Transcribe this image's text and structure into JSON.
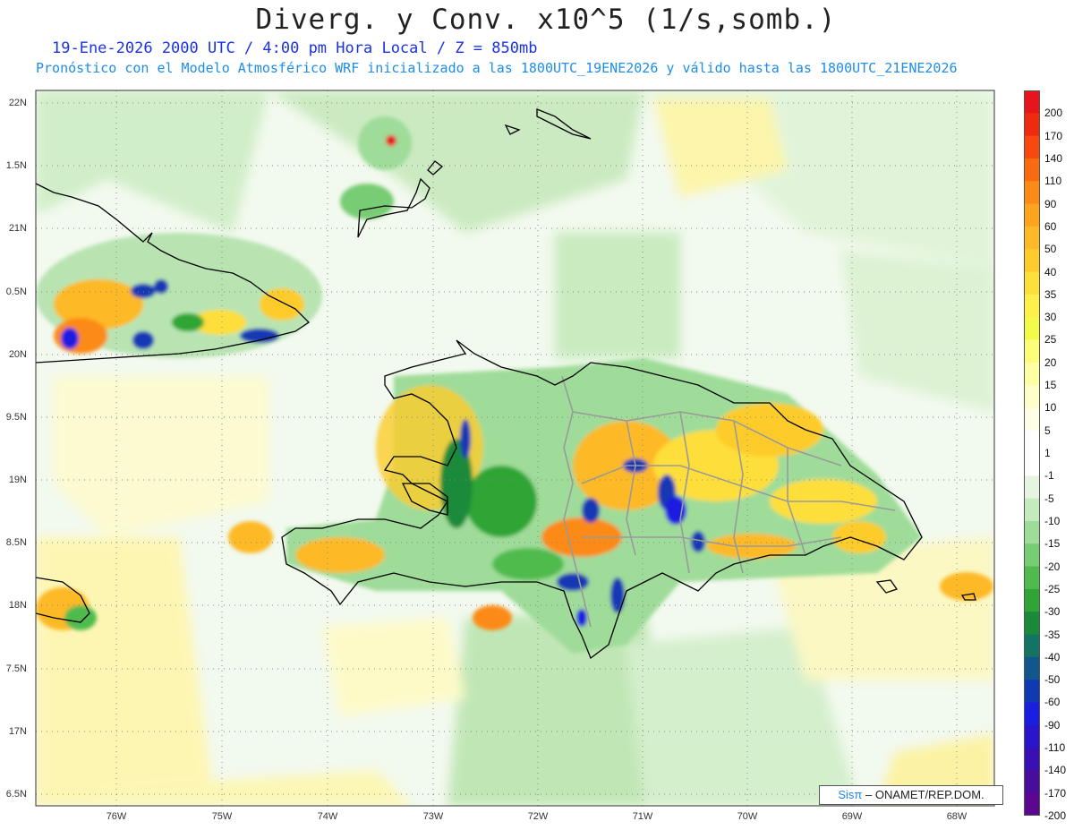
{
  "title": "Diverg. y Conv. x10^5 (1/s,somb.)",
  "subtitle_line1": "19-Ene-2026  2000 UTC / 4:00 pm Hora Local / Z = 850mb",
  "subtitle_line2": "Pronóstico con el Modelo Atmosférico WRF inicializado a las 1800UTC_19ENE2026 y válido hasta las  1800UTC_21ENE2026",
  "lat_labels": [
    "22N",
    "1.5N",
    "21N",
    "0.5N",
    "20N",
    "9.5N",
    "19N",
    "8.5N",
    "18N",
    "7.5N",
    "17N",
    "6.5N"
  ],
  "lon_labels": [
    "76W",
    "75W",
    "74W",
    "73W",
    "72W",
    "71W",
    "70W",
    "69W",
    "68W"
  ],
  "colorbar": {
    "labels": [
      "200",
      "170",
      "140",
      "110",
      "90",
      "60",
      "50",
      "40",
      "35",
      "30",
      "25",
      "20",
      "15",
      "10",
      "5",
      "1",
      "-1",
      "-5",
      "-10",
      "-15",
      "-20",
      "-25",
      "-30",
      "-35",
      "-40",
      "-50",
      "-60",
      "-90",
      "-110",
      "-140",
      "-170",
      "-200"
    ],
    "colors": [
      "#e8141b",
      "#f02a0f",
      "#f7490c",
      "#fa6a0f",
      "#fc8a14",
      "#fda41c",
      "#fdb928",
      "#fdcc2b",
      "#fede3a",
      "#fef04a",
      "#f4fa4a",
      "#fdfd7a",
      "#fefea2",
      "#fefec8",
      "#fefee6",
      "#ffffff",
      "#ffffff",
      "#e6f5e0",
      "#c5eac0",
      "#9fdc99",
      "#78cc73",
      "#4fbb4e",
      "#2ea536",
      "#1a8a3a",
      "#137463",
      "#12568e",
      "#1239b4",
      "#1a1ee0",
      "#2a14cc",
      "#3a10b4",
      "#4a0c9c",
      "#5a0890"
    ]
  },
  "credit": {
    "sis": "Sisπ",
    "rest": "– ONAMET/REP.DOM."
  },
  "colors": {
    "title": "#222222",
    "subtitle1": "#1a32e6",
    "subtitle2": "#1e8de8",
    "coast": "#000000",
    "borders": "#9a9a9a"
  }
}
